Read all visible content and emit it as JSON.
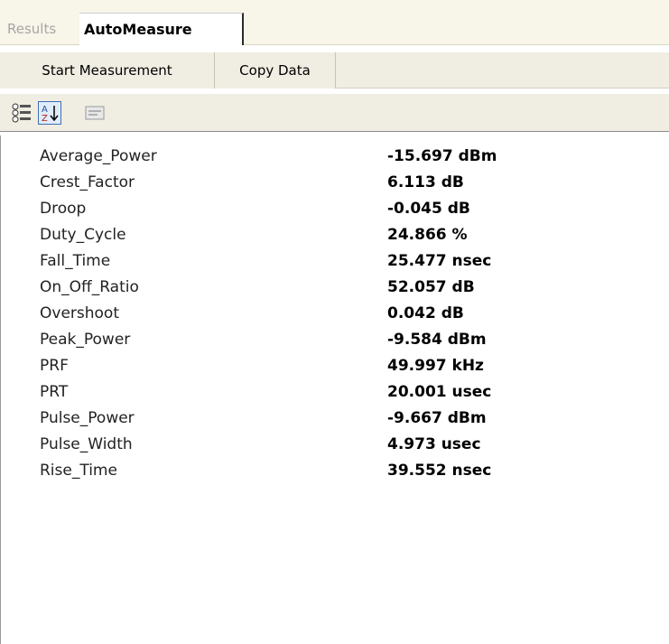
{
  "tabs": [
    {
      "label": "Results",
      "active": false
    },
    {
      "label": "AutoMeasure",
      "active": true
    }
  ],
  "toolbar": {
    "start_label": "Start Measurement",
    "copy_label": "Copy Data"
  },
  "icons": [
    "categorized-icon",
    "sort-alphabetical-icon",
    "property-pages-icon"
  ],
  "measurements": [
    {
      "name": "Average_Power",
      "value": "-15.697 dBm"
    },
    {
      "name": "Crest_Factor",
      "value": "6.113 dB"
    },
    {
      "name": "Droop",
      "value": "-0.045 dB"
    },
    {
      "name": "Duty_Cycle",
      "value": "24.866 %"
    },
    {
      "name": "Fall_Time",
      "value": "25.477 nsec"
    },
    {
      "name": "On_Off_Ratio",
      "value": "52.057 dB"
    },
    {
      "name": "Overshoot",
      "value": "0.042 dB"
    },
    {
      "name": "Peak_Power",
      "value": "-9.584 dBm"
    },
    {
      "name": "PRF",
      "value": "49.997 kHz"
    },
    {
      "name": "PRT",
      "value": "20.001 usec"
    },
    {
      "name": "Pulse_Power",
      "value": "-9.667 dBm"
    },
    {
      "name": "Pulse_Width",
      "value": "4.973 usec"
    },
    {
      "name": "Rise_Time",
      "value": "39.552 nsec"
    }
  ]
}
